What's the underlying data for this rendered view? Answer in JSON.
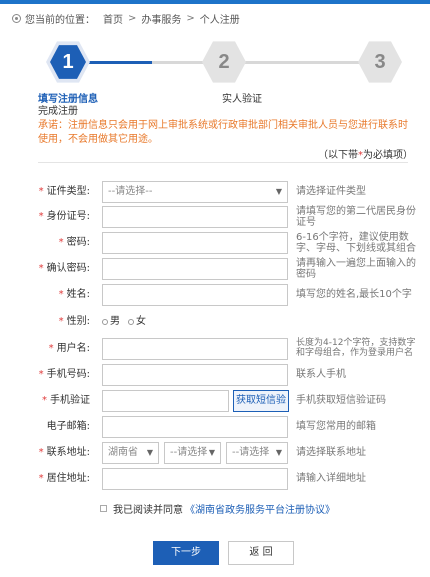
{
  "breadcrumb": {
    "prefix": "您当前的位置：",
    "items": [
      "首页",
      "办事服务",
      "个人注册"
    ],
    "separator": ">"
  },
  "steps": [
    {
      "number": "1",
      "label": "填写注册信息",
      "state": "active"
    },
    {
      "number": "2",
      "label": "实人验证",
      "state": "pending"
    },
    {
      "number": "3",
      "label": "",
      "state": "pending"
    }
  ],
  "done_label": "完成注册",
  "notice": "承诺：注册信息只会用于网上审批系统或行政审批部门相关审批人员与您进行联系时使用，不会用做其它用途。",
  "required_note": {
    "prefix": "（以下带",
    "star": "*",
    "suffix": "为必填项）"
  },
  "form": {
    "cert_type": {
      "label": "证件类型:",
      "placeholder": "--请选择--",
      "hint": "请选择证件类型"
    },
    "id_number": {
      "label": "身份证号:",
      "hint": "请填写您的第二代居民身份证号"
    },
    "password": {
      "label": "密码:",
      "hint": "6-16个字符，建议使用数字、字母、下划线或其组合"
    },
    "confirm_password": {
      "label": "确认密码:",
      "hint": "请再输入一遍您上面输入的密码"
    },
    "name": {
      "label": "姓名:",
      "hint": "填写您的姓名,最长10个字"
    },
    "gender": {
      "label": "性别:",
      "options": [
        "男",
        "女"
      ]
    },
    "username": {
      "label": "用户名:",
      "hint": "长度为4-12个字符，支持数字和字母组合，作为登录用户名"
    },
    "phone": {
      "label": "手机号码:",
      "hint": "联系人手机"
    },
    "sms_verify": {
      "label": "手机验证",
      "button": "获取短信验",
      "hint": "手机获取短信验证码"
    },
    "email": {
      "label": "电子邮箱:",
      "hint": "填写您常用的邮箱"
    },
    "address_region": {
      "label": "联系地址:",
      "province": "湖南省",
      "city": "--请选择",
      "district": "--请选择",
      "hint": "请选择联系地址"
    },
    "residence": {
      "label": "居住地址:",
      "hint": "请输入详细地址"
    }
  },
  "agreement": {
    "text": "我已阅读并同意",
    "link": "《湖南省政务服务平台注册协议》"
  },
  "buttons": {
    "next": "下一步",
    "back": "返 回"
  },
  "colors": {
    "primary": "#1d5fb6",
    "notice": "#e8792b",
    "required": "#e03a3a"
  }
}
